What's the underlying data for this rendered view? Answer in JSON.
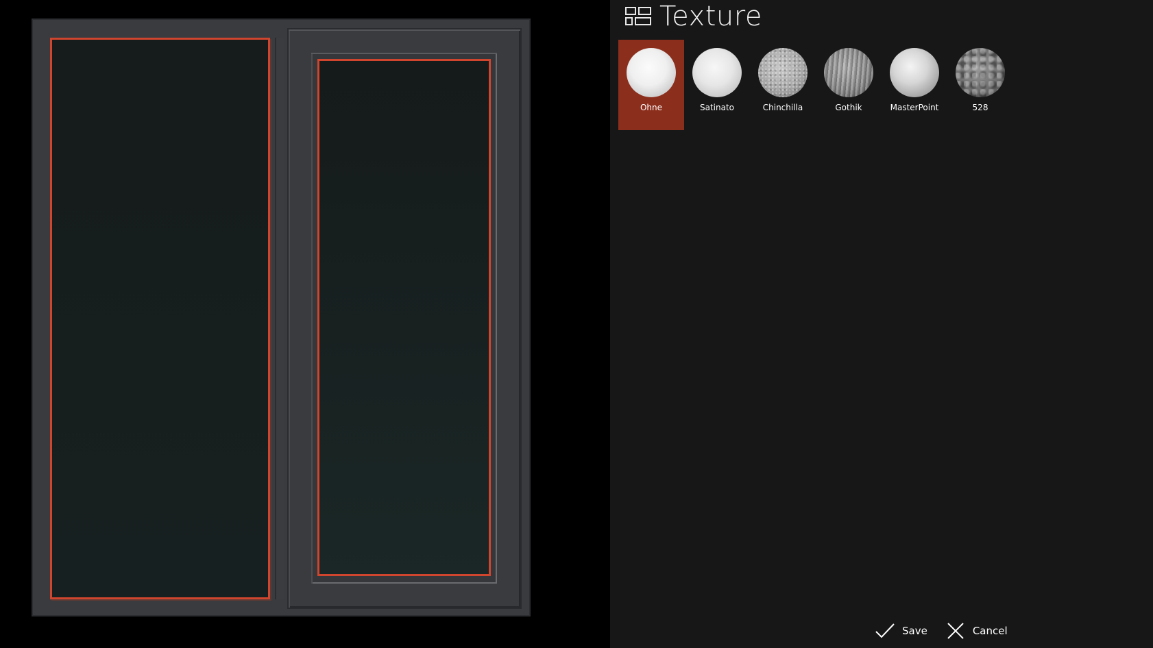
{
  "panel": {
    "title": "Texture",
    "header_icon": "layout-icon",
    "accent_color": "#8c2e1c"
  },
  "textures": {
    "selected": "Ohne",
    "items": [
      {
        "label": "Ohne"
      },
      {
        "label": "Satinato"
      },
      {
        "label": "Chinchilla"
      },
      {
        "label": "Gothik"
      },
      {
        "label": "MasterPoint"
      },
      {
        "label": "528"
      }
    ]
  },
  "actions": {
    "save_label": "Save",
    "cancel_label": "Cancel",
    "save_icon": "checkmark-icon",
    "cancel_icon": "close-icon"
  },
  "preview": {
    "frame_color": "#3a3b3e",
    "glass_border_color": "#d0452e"
  }
}
